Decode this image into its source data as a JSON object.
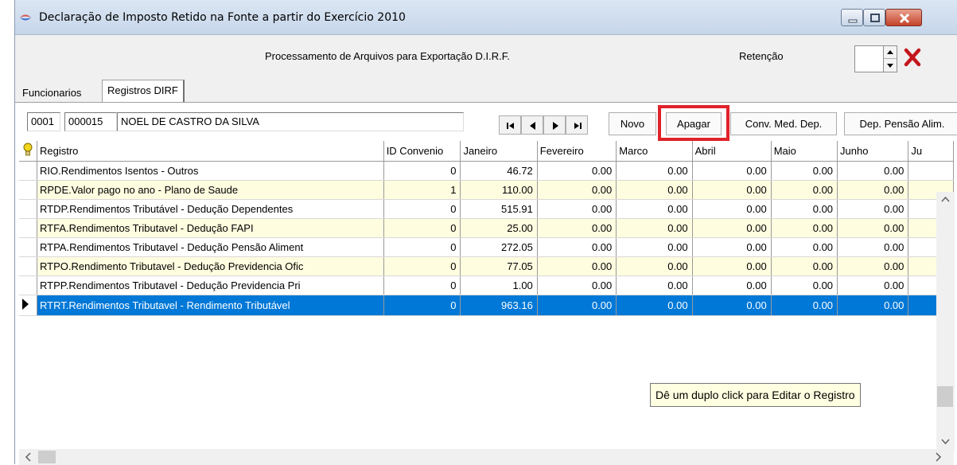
{
  "window": {
    "title": "Declaração de Imposto Retido na Fonte a partir do Exercício 2010"
  },
  "header": {
    "processing_label": "Processamento de Arquivos para Exportação D.I.R.F.",
    "retention_label": "Retenção",
    "retention_value": ""
  },
  "tabs": [
    {
      "label": "Funcionarios",
      "active": false
    },
    {
      "label": "Registros DIRF",
      "active": true
    }
  ],
  "record": {
    "company": "0001",
    "employee_id": "000015",
    "employee_name": "NOEL DE CASTRO DA SILVA"
  },
  "toolbar": {
    "novo": "Novo",
    "apagar": "Apagar",
    "conv_med_dep": "Conv. Med. Dep.",
    "dep_pensao": "Dep. Pensão Alim."
  },
  "grid": {
    "columns": [
      "Registro",
      "ID Convenio",
      "Janeiro",
      "Fevereiro",
      "Marco",
      "Abril",
      "Maio",
      "Junho",
      "Ju"
    ],
    "rows": [
      {
        "registro": "RIO.Rendimentos Isentos - Outros",
        "id": "0",
        "vals": [
          "46.72",
          "0.00",
          "0.00",
          "0.00",
          "0.00",
          "0.00"
        ]
      },
      {
        "registro": "RPDE.Valor pago no ano - Plano de Saude",
        "id": "1",
        "vals": [
          "110.00",
          "0.00",
          "0.00",
          "0.00",
          "0.00",
          "0.00"
        ]
      },
      {
        "registro": "RTDP.Rendimentos Tributável - Dedução Dependentes",
        "id": "0",
        "vals": [
          "515.91",
          "0.00",
          "0.00",
          "0.00",
          "0.00",
          "0.00"
        ]
      },
      {
        "registro": "RTFA.Rendimentos Tributavel - Dedução FAPI",
        "id": "0",
        "vals": [
          "25.00",
          "0.00",
          "0.00",
          "0.00",
          "0.00",
          "0.00"
        ]
      },
      {
        "registro": "RTPA.Rendimentos Tributavel - Dedução Pensão Aliment",
        "id": "0",
        "vals": [
          "272.05",
          "0.00",
          "0.00",
          "0.00",
          "0.00",
          "0.00"
        ]
      },
      {
        "registro": "RTPO.Rendimento Tributavel - Dedução Previdencia Ofic",
        "id": "0",
        "vals": [
          "77.05",
          "0.00",
          "0.00",
          "0.00",
          "0.00",
          "0.00"
        ]
      },
      {
        "registro": "RTPP.Rendimentos Tributavel - Dedução Previdencia Pri",
        "id": "0",
        "vals": [
          "1.00",
          "0.00",
          "0.00",
          "0.00",
          "0.00",
          "0.00"
        ]
      },
      {
        "registro": "RTRT.Rendimentos Tributavel - Rendimento Tributável",
        "id": "0",
        "vals": [
          "963.16",
          "0.00",
          "0.00",
          "0.00",
          "0.00",
          "0.00"
        ]
      }
    ],
    "selected_row": 7
  },
  "tooltip": "Dê um duplo click para Editar o Registro",
  "colors": {
    "selection": "#0078d7",
    "row_alt": "#fffde0",
    "highlight": "#e0222b"
  }
}
